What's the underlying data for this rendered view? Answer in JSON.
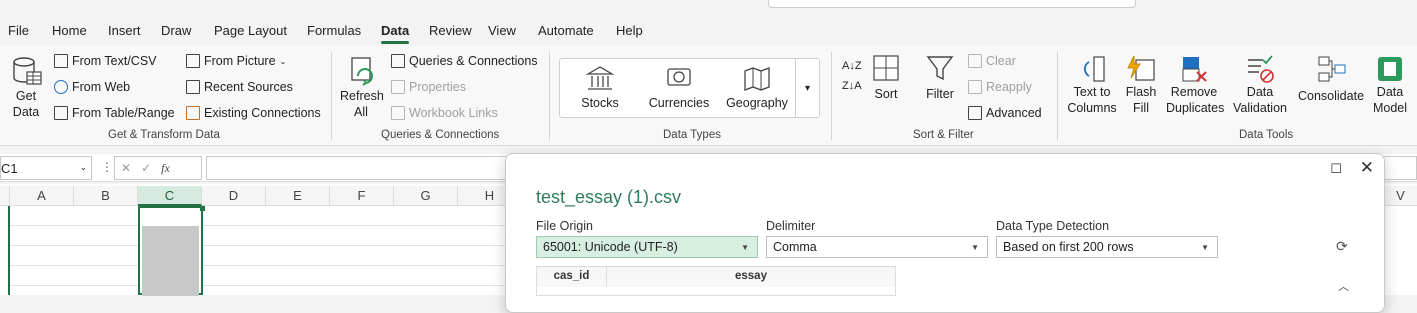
{
  "menu": {
    "items": [
      "File",
      "Home",
      "Insert",
      "Draw",
      "Page Layout",
      "Formulas",
      "Data",
      "Review",
      "View",
      "Automate",
      "Help"
    ],
    "active": "Data"
  },
  "ribbon": {
    "get_transform": {
      "get_data": "Get\nData",
      "from_text_csv": "From Text/CSV",
      "from_web": "From Web",
      "from_table": "From Table/Range",
      "from_picture": "From Picture",
      "recent_sources": "Recent Sources",
      "existing_connections": "Existing Connections",
      "label": "Get & Transform Data"
    },
    "queries": {
      "refresh_all": "Refresh\nAll",
      "queries_connections": "Queries & Connections",
      "properties": "Properties",
      "workbook_links": "Workbook Links",
      "label": "Queries & Connections"
    },
    "data_types": {
      "stocks": "Stocks",
      "currencies": "Currencies",
      "geography": "Geography",
      "label": "Data Types"
    },
    "sort_filter": {
      "sort": "Sort",
      "filter": "Filter",
      "clear": "Clear",
      "reapply": "Reapply",
      "advanced": "Advanced",
      "label": "Sort & Filter"
    },
    "data_tools": {
      "text_to_columns": "Text to\nColumns",
      "flash_fill": "Flash\nFill",
      "remove_duplicates": "Remove\nDuplicates",
      "data_validation": "Data\nValidation",
      "consolidate": "Consolidate",
      "data_model": "Data\nModel",
      "label": "Data Tools"
    }
  },
  "formula_bar": {
    "name_box": "C1",
    "fx": "fx"
  },
  "grid": {
    "columns": [
      "A",
      "B",
      "C",
      "D",
      "E",
      "F",
      "G",
      "H"
    ],
    "far_column": "V"
  },
  "dialog": {
    "title": "test_essay (1).csv",
    "file_origin_label": "File Origin",
    "file_origin_value": "65001: Unicode (UTF-8)",
    "delimiter_label": "Delimiter",
    "delimiter_value": "Comma",
    "detection_label": "Data Type Detection",
    "detection_value": "Based on first 200 rows",
    "preview_headers": [
      "cas_id",
      "essay"
    ]
  },
  "colors": {
    "accent": "#217346",
    "title_green": "#2f7d5a",
    "selected_select_bg": "#d7efe0"
  }
}
